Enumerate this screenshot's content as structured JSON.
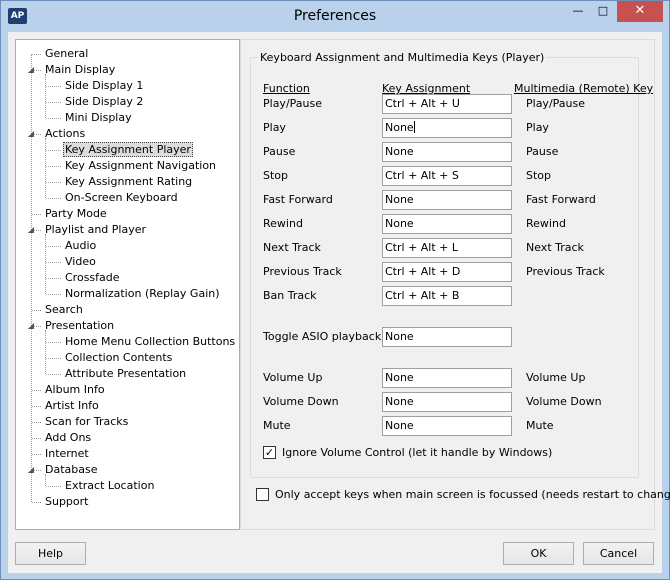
{
  "window": {
    "title": "Preferences",
    "app_icon_text": "AP",
    "min_glyph": "—",
    "max_glyph": "□",
    "close_glyph": "✕"
  },
  "tree": {
    "items": [
      {
        "label": "General"
      },
      {
        "label": "Main Display"
      },
      {
        "label": "Side Display 1"
      },
      {
        "label": "Side Display 2"
      },
      {
        "label": "Mini Display"
      },
      {
        "label": "Actions"
      },
      {
        "label": "Key Assignment Player"
      },
      {
        "label": "Key Assignment Navigation"
      },
      {
        "label": "Key Assignment Rating"
      },
      {
        "label": "On-Screen Keyboard"
      },
      {
        "label": "Party Mode"
      },
      {
        "label": "Playlist and Player"
      },
      {
        "label": "Audio"
      },
      {
        "label": "Video"
      },
      {
        "label": "Crossfade"
      },
      {
        "label": "Normalization (Replay Gain)"
      },
      {
        "label": "Search"
      },
      {
        "label": "Presentation"
      },
      {
        "label": "Home Menu Collection Buttons"
      },
      {
        "label": "Collection Contents"
      },
      {
        "label": "Attribute Presentation"
      },
      {
        "label": "Album Info"
      },
      {
        "label": "Artist Info"
      },
      {
        "label": "Scan for Tracks"
      },
      {
        "label": "Add Ons"
      },
      {
        "label": "Internet"
      },
      {
        "label": "Database"
      },
      {
        "label": "Extract Location"
      },
      {
        "label": "Support"
      }
    ]
  },
  "panel": {
    "group_title": "Keyboard Assignment and Multimedia Keys (Player)",
    "headers": {
      "function": "Function",
      "key": "Key Assignment",
      "media": "Multimedia (Remote) Key"
    },
    "rows": [
      {
        "label": "Play/Pause",
        "key": "Ctrl + Alt + U",
        "media": "Play/Pause"
      },
      {
        "label": "Play",
        "key": "None",
        "media": "Play"
      },
      {
        "label": "Pause",
        "key": "None",
        "media": "Pause"
      },
      {
        "label": "Stop",
        "key": "Ctrl + Alt + S",
        "media": "Stop"
      },
      {
        "label": "Fast Forward",
        "key": "None",
        "media": "Fast Forward"
      },
      {
        "label": "Rewind",
        "key": "None",
        "media": "Rewind"
      },
      {
        "label": "Next Track",
        "key": "Ctrl + Alt + L",
        "media": "Next Track"
      },
      {
        "label": "Previous Track",
        "key": "Ctrl + Alt + D",
        "media": "Previous Track"
      },
      {
        "label": "Ban Track",
        "key": "Ctrl + Alt + B",
        "media": ""
      },
      {
        "label": "Toggle ASIO playback",
        "key": "None",
        "media": ""
      },
      {
        "label": "Volume Up",
        "key": "None",
        "media": "Volume Up"
      },
      {
        "label": "Volume Down",
        "key": "None",
        "media": "Volume Down"
      },
      {
        "label": "Mute",
        "key": "None",
        "media": "Mute"
      }
    ],
    "ignore_volume_label": "Ignore Volume Control (let it handle by Windows)",
    "ignore_volume_checked": true,
    "focus_only_label": "Only accept keys when main screen is focussed (needs restart to change)",
    "focus_only_checked": false
  },
  "buttons": {
    "help": "Help",
    "ok": "OK",
    "cancel": "Cancel"
  }
}
